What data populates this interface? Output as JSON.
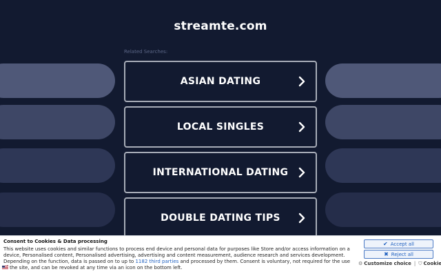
{
  "site": {
    "title": "streamte.com",
    "related_label": "Related Searches:"
  },
  "searches": [
    {
      "label": "ASIAN DATING",
      "icon": "chevron-right-icon"
    },
    {
      "label": "LOCAL SINGLES",
      "icon": "chevron-right-icon"
    },
    {
      "label": "INTERNATIONAL DATING",
      "icon": "chevron-right-icon"
    },
    {
      "label": "DOUBLE DATING TIPS",
      "icon": "chevron-right-icon"
    }
  ],
  "side_pills": {
    "colors": [
      "#4f5878",
      "#3e4766",
      "#2e3756",
      "#252d4a"
    ]
  },
  "colors": {
    "background": "#121a30",
    "button_border": "#a8adb8",
    "link": "#1e5fbf"
  },
  "cookie": {
    "title": "Consent to Cookies & Data processing",
    "text_before_link": "This website uses cookies and similar functions to process end device and personal data for purposes like Store and/or access information on a device, Personalised content, Personalised advertising, advertising and content measurement, audience research and services development. Depending on the function, data is passed on to up to ",
    "link_text": "1182 third parties",
    "text_after_link": " and processed by them. Consent is voluntary, not required for the use of the site, and can be revoked at any time via an icon on the bottom left.",
    "accept_label": "Accept all",
    "reject_label": "Reject all",
    "customize_label": "Customize choice",
    "separator": "|",
    "cookies_label": "Cookies"
  }
}
